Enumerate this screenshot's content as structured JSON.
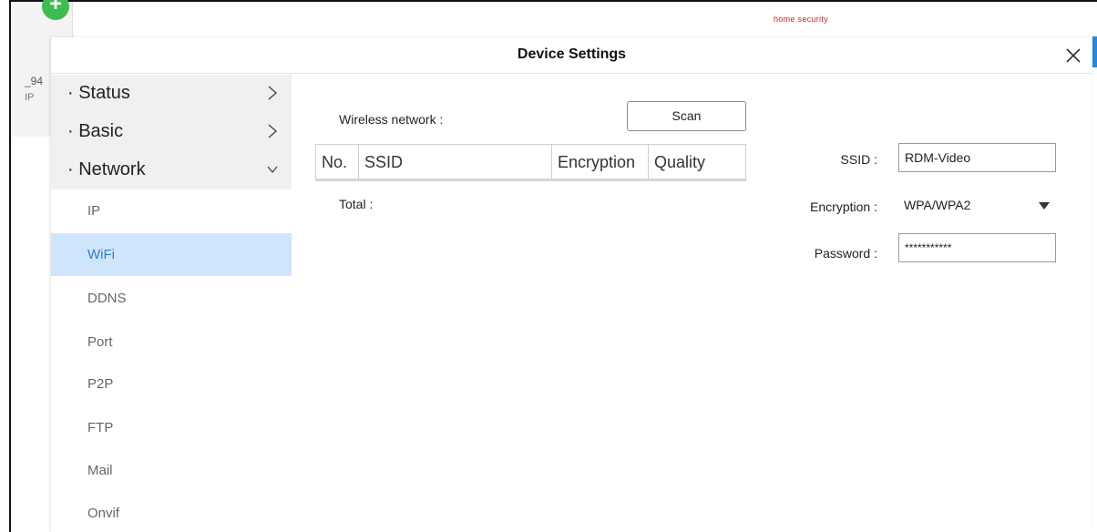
{
  "background": {
    "text_1": "_94",
    "text_2": "IP",
    "brand": "home security",
    "plus_icon": "+"
  },
  "dialog": {
    "title": "Device Settings",
    "close_icon": "close-icon"
  },
  "sidebar": {
    "groups": [
      {
        "label": "· Status",
        "chevron": "right"
      },
      {
        "label": "· Basic",
        "chevron": "right"
      },
      {
        "label": "· Network",
        "chevron": "down"
      }
    ],
    "network_items": [
      {
        "label": "IP"
      },
      {
        "label": "WiFi",
        "active": true
      },
      {
        "label": "DDNS"
      },
      {
        "label": "Port"
      },
      {
        "label": "P2P"
      },
      {
        "label": "FTP"
      },
      {
        "label": "Mail"
      },
      {
        "label": "Onvif"
      }
    ]
  },
  "wifi": {
    "wireless_network_label": "Wireless network :",
    "scan_button": "Scan",
    "table_columns": [
      "No.",
      "SSID",
      "Encryption",
      "Quality"
    ],
    "total_label": "Total :",
    "ssid_label": "SSID :",
    "ssid_value": "RDM-Video",
    "encryption_label": "Encryption :",
    "encryption_value": "WPA/WPA2",
    "password_label": "Password :",
    "password_value": "***********"
  },
  "colors": {
    "active_bg": "#cfe5fb",
    "active_text": "#2a7fd4",
    "brand_red": "#d02424",
    "plus_green": "#3ebd4f"
  }
}
